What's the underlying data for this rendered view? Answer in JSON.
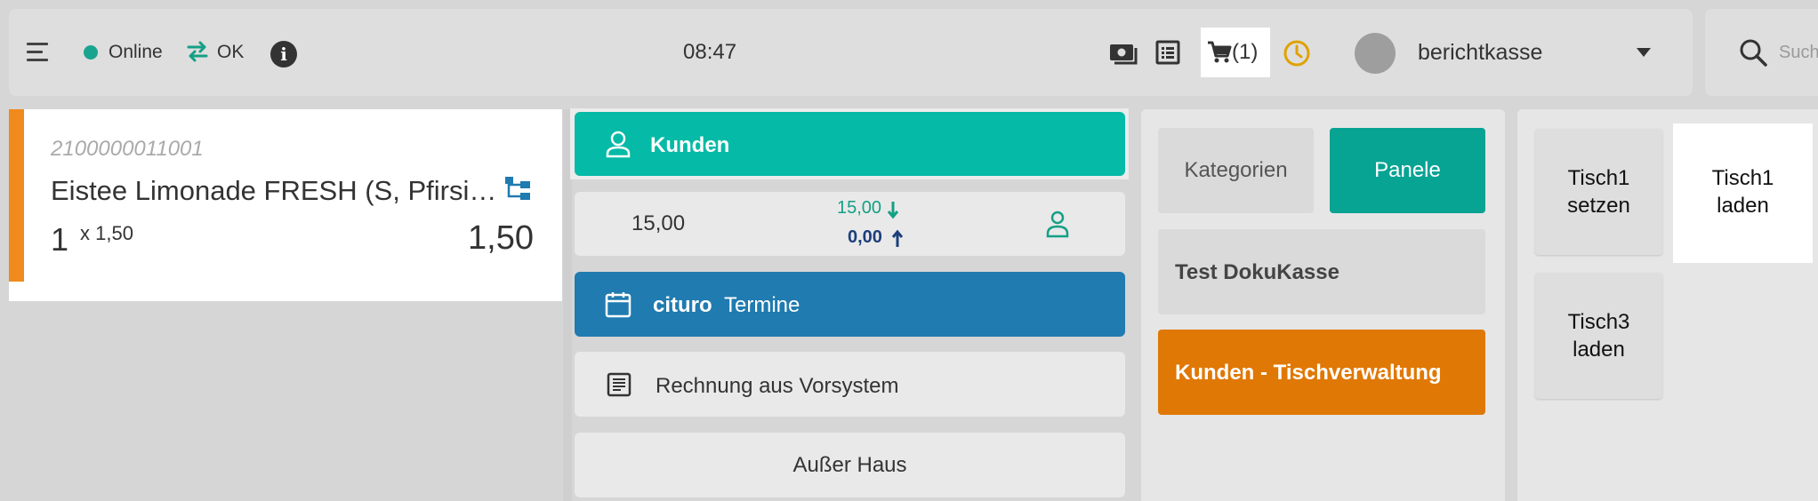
{
  "topbar": {
    "status_label": "Online",
    "sync_label": "OK",
    "time": "08:47",
    "cart_count": "(1)",
    "username": "berichtkasse",
    "search_placeholder": "Such"
  },
  "icons": {
    "menu": "hamburger-menu-icon",
    "status": "online-dot-icon",
    "sync": "sync-arrows-icon",
    "info": "info-icon",
    "cash": "cash-register-icon",
    "list": "list-icon",
    "cart": "cart-icon",
    "clock": "clock-icon",
    "search": "search-icon"
  },
  "line_item": {
    "code": "2100000011001",
    "name": "Eistee Limonade FRESH (S, Pfirsi…",
    "quantity": "1",
    "unit_price": "x 1,50",
    "total": "1,50"
  },
  "actions": {
    "kunden_label": "Kunden",
    "balance_main": "15,00",
    "balance_in": "15,00",
    "balance_out": "0,00",
    "termine_brand": "cituro",
    "termine_label": "Termine",
    "rechnung_label": "Rechnung aus Vorsystem",
    "ausser_label": "Außer Haus"
  },
  "categories": {
    "tab_kategorien": "Kategorien",
    "tab_panele": "Panele",
    "items": [
      {
        "label": "Test DokuKasse"
      },
      {
        "label": "Kunden - Tischverwaltung"
      }
    ]
  },
  "panel_tiles": [
    {
      "line1": "Tisch1",
      "line2": "setzen"
    },
    {
      "line1": "Tisch1",
      "line2": "laden"
    },
    {
      "line1": "Tisch3",
      "line2": "laden"
    }
  ],
  "colors": {
    "teal": "#05baa6",
    "panel_green": "#07a393",
    "blue": "#1f7bb0",
    "orange": "#e07805",
    "item_stripe": "#f08a1c"
  }
}
